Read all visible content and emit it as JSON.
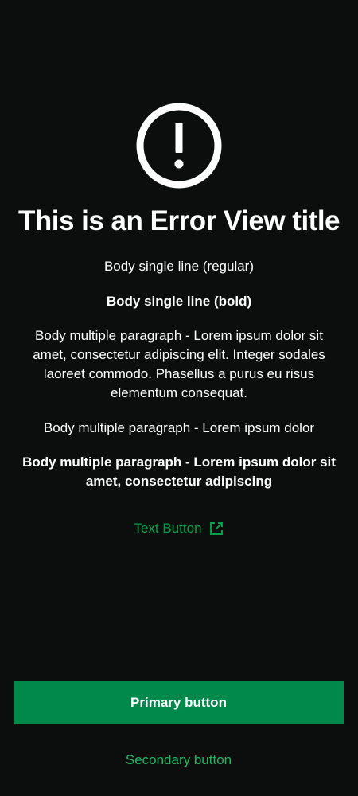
{
  "error_view": {
    "icon": "exclamation-circle-icon",
    "title": "This is an Error View title",
    "body_regular": "Body single line (regular)",
    "body_bold": "Body single line (bold)",
    "body_paragraph_1": "Body multiple paragraph - Lorem ipsum dolor sit amet, consectetur adipiscing elit. Integer sodales laoreet commodo. Phasellus a purus eu risus elementum consequat.",
    "body_paragraph_2": "Body multiple paragraph - Lorem ipsum dolor",
    "body_paragraph_bold": "Body multiple paragraph - Lorem ipsum dolor sit amet, consectetur adipiscing",
    "text_button": {
      "label": "Text Button",
      "icon": "external-link-icon"
    },
    "primary_button": "Primary button",
    "secondary_button": "Secondary button"
  },
  "colors": {
    "background": "#0c0e0e",
    "text": "#ffffff",
    "primary": "#00894b",
    "link": "#00a04a",
    "secondary_link": "#1fb863"
  }
}
